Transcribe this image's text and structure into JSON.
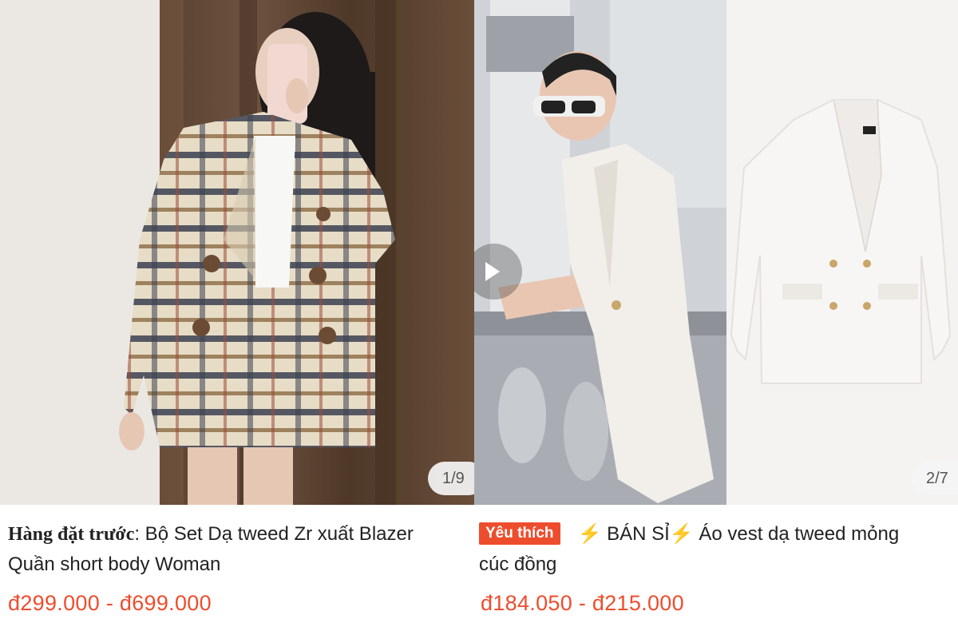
{
  "products": [
    {
      "image_counter": "1/9",
      "preorder_label": "Hàng đặt trước",
      "title_line1": ": Bộ Set Dạ tweed Zr xuất Blazer",
      "title_line2": "Quần short body Woman",
      "price": "đ299.000 - đ699.000"
    },
    {
      "image_counter": "2/7",
      "badge": "Yêu thích",
      "bolt": "⚡",
      "title_line1": "BÁN SỈ",
      "title_line1b": "Áo vest dạ tweed mỏng",
      "title_line2": "cúc đồng",
      "price": "đ184.050 - đ215.000"
    }
  ],
  "colors": {
    "price": "#ee4d2d",
    "badge_bg": "#ee4d2d",
    "bolt": "#f5b400"
  }
}
